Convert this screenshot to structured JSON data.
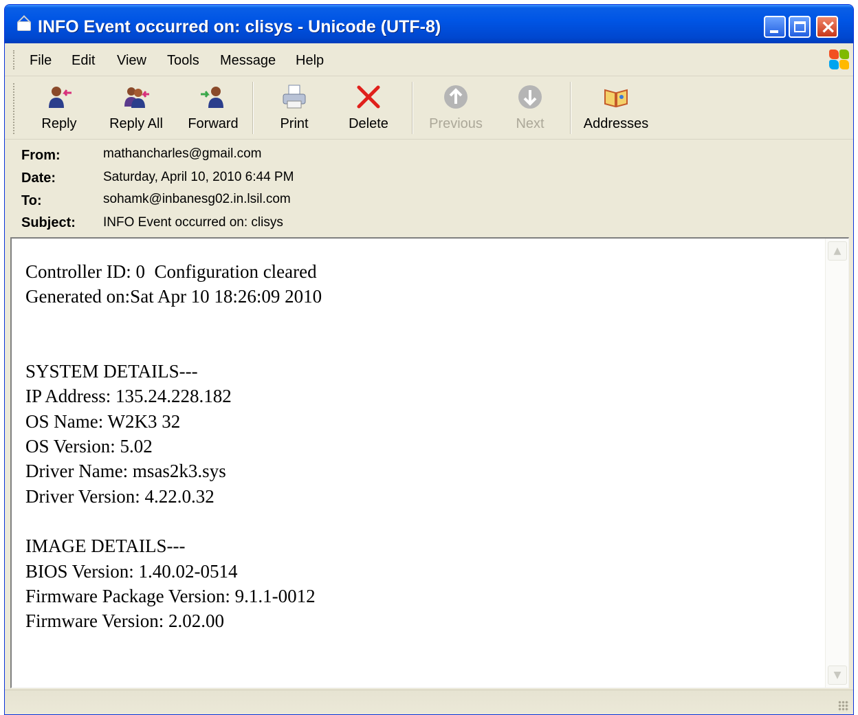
{
  "window": {
    "title": "INFO  Event occurred on: clisys - Unicode (UTF-8)"
  },
  "menu": {
    "items": [
      "File",
      "Edit",
      "View",
      "Tools",
      "Message",
      "Help"
    ]
  },
  "toolbar": {
    "reply": "Reply",
    "reply_all": "Reply All",
    "forward": "Forward",
    "print": "Print",
    "delete": "Delete",
    "previous": "Previous",
    "next": "Next",
    "addresses": "Addresses"
  },
  "headers": {
    "from_label": "From:",
    "from": "mathancharles@gmail.com",
    "date_label": "Date:",
    "date": "Saturday, April 10, 2010 6:44 PM",
    "to_label": "To:",
    "to": "sohamk@inbanesg02.in.lsil.com",
    "subject_label": "Subject:",
    "subject": "INFO  Event occurred on: clisys"
  },
  "message": {
    "lines": [
      "Controller ID: 0  Configuration cleared",
      "Generated on:Sat Apr 10 18:26:09 2010",
      "",
      "",
      "SYSTEM DETAILS---",
      "IP Address: 135.24.228.182",
      "OS Name: W2K3 32",
      "OS Version: 5.02",
      "Driver Name: msas2k3.sys",
      "Driver Version: 4.22.0.32",
      "",
      "IMAGE DETAILS---",
      "BIOS Version: 1.40.02-0514",
      "Firmware Package Version: 9.1.1-0012",
      "Firmware Version: 2.02.00"
    ]
  },
  "icons": {
    "title": "envelope-icon",
    "reply": "reply-icon",
    "reply_all": "reply-all-icon",
    "forward": "forward-icon",
    "print": "printer-icon",
    "delete": "delete-x-icon",
    "previous": "up-arrow-icon",
    "next": "down-arrow-icon",
    "addresses": "address-book-icon"
  },
  "colors": {
    "titlebar": "#0055e5",
    "chrome": "#ece9d8",
    "delete_red": "#e0201b",
    "disabled_text": "#aca899"
  }
}
